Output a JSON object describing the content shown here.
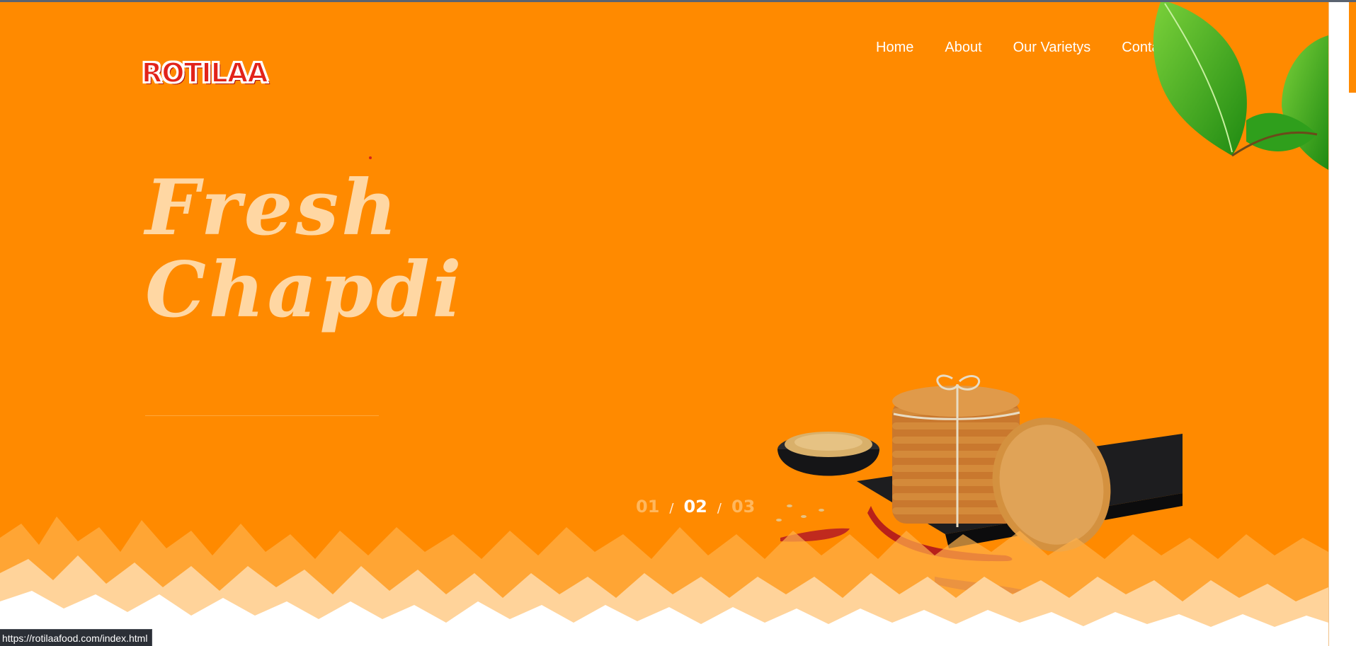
{
  "brand": {
    "logo_text": "ROTILAA"
  },
  "nav": {
    "items": [
      {
        "label": "Home"
      },
      {
        "label": "About"
      },
      {
        "label": "Our Varietys"
      },
      {
        "label": "Contact Us"
      }
    ]
  },
  "hero": {
    "title_line1": "Fresh",
    "title_line2": "Chapdi"
  },
  "slider": {
    "pages": [
      "01",
      "02",
      "03"
    ],
    "separator": "/",
    "active_index": 1
  },
  "status_bar": {
    "url": "https://rotilaafood.com/index.html"
  },
  "colors": {
    "hero_background": "#ff8a00",
    "title_color": "#ffd7a3",
    "logo_red": "#e2231a",
    "nav_text": "#ffffff"
  },
  "icons": {
    "decoration_top_right": "green-leaves",
    "product_image": "chapdi-stack-with-wheat-and-chilies"
  }
}
